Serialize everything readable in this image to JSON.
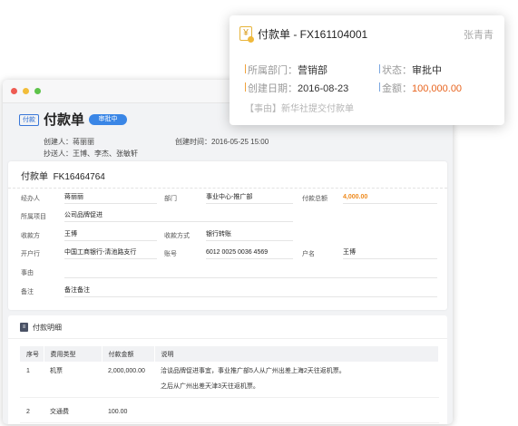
{
  "window": {
    "controls": [
      "close",
      "minimize",
      "maximize"
    ]
  },
  "header": {
    "badge": "付款",
    "title": "付款单",
    "status": "审批中",
    "creator_label": "创建人：",
    "creator": "蒋丽丽",
    "created_time_label": "创建时间：",
    "created_time": "2016-05-25 15:00",
    "cc_label": "抄送人：",
    "cc": "王博、李杰、张敏轩"
  },
  "form": {
    "title": "付款单",
    "number": "FK16464764",
    "fields": {
      "handler": {
        "label": "经办人",
        "value": "蒋丽丽"
      },
      "department": {
        "label": "部门",
        "value": "事业中心-推广部"
      },
      "total": {
        "label": "付款总额",
        "value": "4,000.00"
      },
      "project": {
        "label": "所属项目",
        "value": "公司品牌促进"
      },
      "payee": {
        "label": "收款方",
        "value": "王博"
      },
      "method": {
        "label": "收款方式",
        "value": "银行转账"
      },
      "bank": {
        "label": "开户行",
        "value": "中国工商银行-清池路支行"
      },
      "account": {
        "label": "账号",
        "value": "6012 0025 0036 4569"
      },
      "account_name": {
        "label": "户名",
        "value": "王博"
      },
      "reason": {
        "label": "事由",
        "value": ""
      },
      "remark": {
        "label": "备注",
        "value": "备注备注"
      }
    }
  },
  "detail": {
    "icon": "clipboard-icon",
    "title": "付款明细",
    "columns": [
      "序号",
      "费用类型",
      "付款金额",
      "说明"
    ],
    "rows": [
      {
        "no": "1",
        "type": "机票",
        "amount": "2,000,000.00",
        "desc1": "洽谈品牌促进事宜，事业推广部5人从广州出差上海2天往返机票。",
        "desc2": "之后从广州出差天津3天往返机票。"
      },
      {
        "no": "2",
        "type": "交通费",
        "amount": "100.00",
        "desc1": "",
        "desc2": ""
      }
    ]
  },
  "popup": {
    "icon": "yen-document-icon",
    "title": "付款单 - FX161104001",
    "user": "张青青",
    "dept_label": "所属部门：",
    "dept": "营销部",
    "status_label": "状态：",
    "status": "审批中",
    "date_label": "创建日期：",
    "date": "2016-08-23",
    "amount_label": "金额：",
    "amount": "100,000.00",
    "reason": "【事由】新华社提交付款单"
  },
  "colors": {
    "accent": "#3a86e6",
    "amount": "#e8641e",
    "total": "#ee8a1e"
  }
}
